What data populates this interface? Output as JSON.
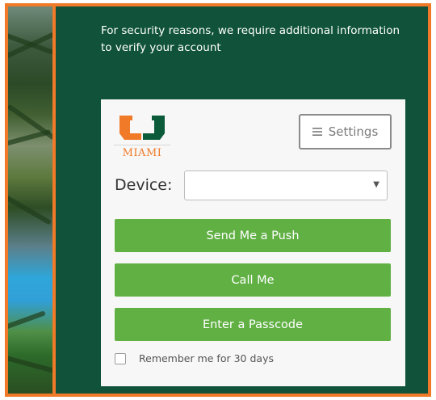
{
  "intro": {
    "line1": "For security reasons, we require additional information",
    "line2": "to verify your account"
  },
  "logo": {
    "wordmark": "MIAMI"
  },
  "settings": {
    "label": "Settings",
    "icon": "hamburger-icon"
  },
  "device": {
    "label": "Device:",
    "value": ""
  },
  "actions": {
    "push": "Send Me a Push",
    "call": "Call Me",
    "passcode": "Enter a Passcode"
  },
  "remember": {
    "label": "Remember me for 30 days",
    "checked": false
  },
  "colors": {
    "background": "#10533a",
    "border": "#f07a28",
    "button": "#60b044",
    "card": "#f7f7f7"
  }
}
